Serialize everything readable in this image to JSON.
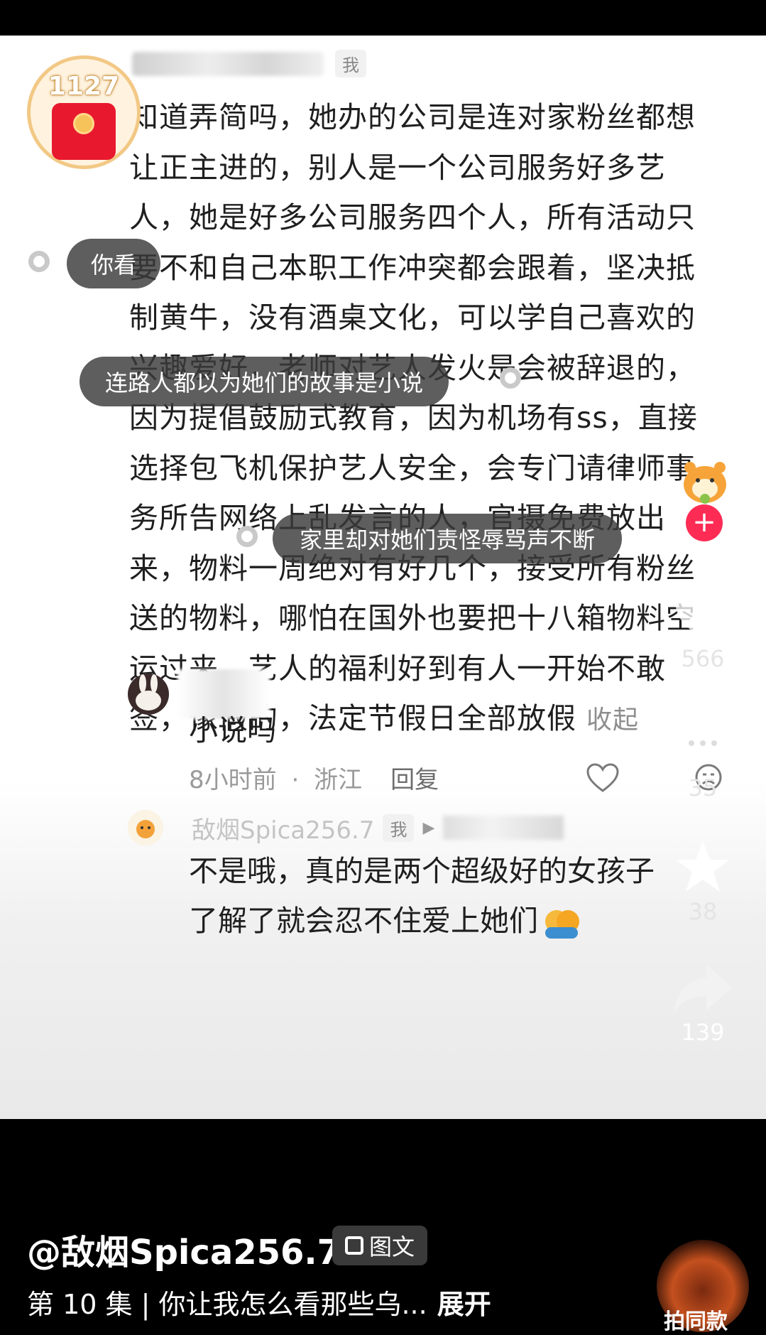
{
  "badge": {
    "count": "1127"
  },
  "comment": {
    "tag_me": "我",
    "text": "知道弄简吗，她办的公司是连对家粉丝都想让正主进的，别人是一个公司服务好多艺人，她是好多公司服务四个人，所有活动只要不和自己本职工作冲突都会跟着，坚决抵制黄牛，没有酒桌文化，可以学自己喜欢的兴趣爱好，老师对艺人发火是会被辞退的，因为提倡鼓励式教育，因为机场有ss，直接选择包飞机保护艺人安全，会专门请律师事务所告网络上乱发言的人，官摄免费放出来，物料一周绝对有好几个，接受所有粉丝送的物料，哪怕在国外也要把十八箱物料空运过来，艺人的福利好到有人一开始不敢签，像假的，法定节假日全部放假",
    "collapse_label": "收起"
  },
  "bubbles": {
    "b1": "你看",
    "b2": "连路人都以为她们的故事是小说",
    "b3": "家里却对她们责怪辱骂声不断"
  },
  "reply1": {
    "text": "小说吗",
    "time": "8小时前",
    "location": "浙江",
    "separator": "·",
    "reply_label": "回复"
  },
  "reply2": {
    "username": "敌烟Spica256.7",
    "tag_me": "我",
    "arrow": "▶",
    "line1": "不是哦，真的是两个超级好的女孩子",
    "line2": "了解了就会忍不住爱上她们"
  },
  "sidebar": {
    "like_count": "566",
    "comment_count": "35",
    "favorite_count": "38",
    "share_count": "139"
  },
  "footer": {
    "author": "@敌烟Spica256.7",
    "tuwen_label": "图文",
    "episode": "第 10 集 | 你让我怎么看那些乌...",
    "expand_label": "展开",
    "music_label": "拍同款"
  },
  "colors": {
    "accent_red": "#fe2c55",
    "like_heart": "#ffffff",
    "badge_red": "#e8192f"
  }
}
